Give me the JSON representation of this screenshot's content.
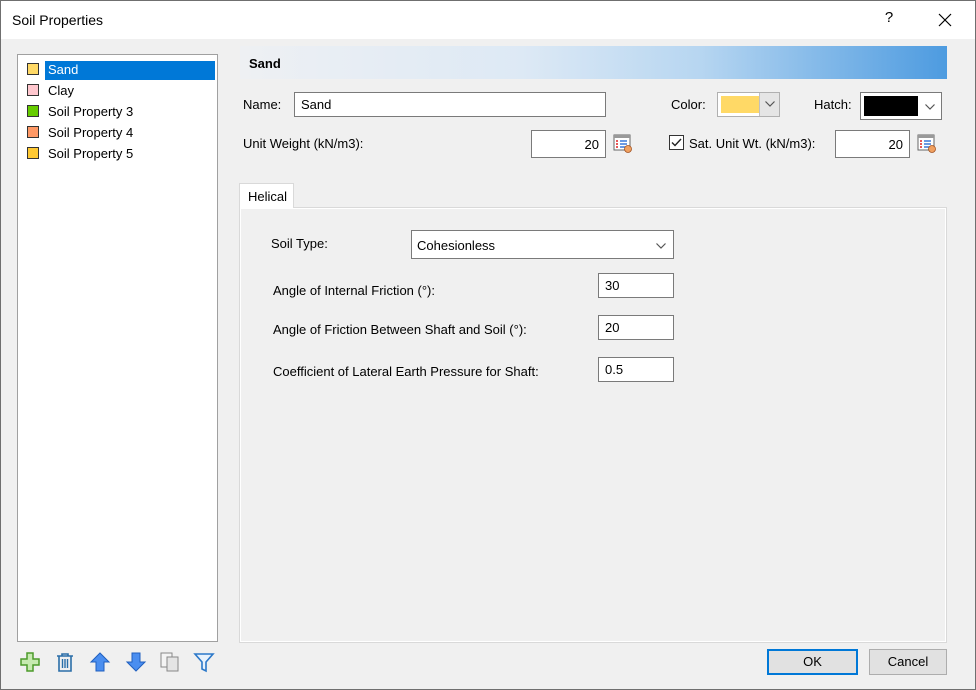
{
  "window": {
    "title": "Soil Properties",
    "help_label": "?",
    "close_icon": "close-icon"
  },
  "soil_list": {
    "items": [
      {
        "label": "Sand",
        "color": "#ffd966",
        "selected": true
      },
      {
        "label": "Clay",
        "color": "#ffc7ce",
        "selected": false
      },
      {
        "label": "Soil Property 3",
        "color": "#66cc00",
        "selected": false
      },
      {
        "label": "Soil Property 4",
        "color": "#ff9966",
        "selected": false
      },
      {
        "label": "Soil Property 5",
        "color": "#ffc933",
        "selected": false
      }
    ],
    "toolbar": [
      "add-icon",
      "delete-icon",
      "move-up-icon",
      "move-down-icon",
      "copy-icon",
      "filter-icon"
    ]
  },
  "header": {
    "title": "Sand"
  },
  "properties": {
    "name_label": "Name:",
    "name_value": "Sand",
    "color_label": "Color:",
    "color_value": "#ffd966",
    "hatch_label": "Hatch:",
    "hatch_value": "#000000",
    "unit_weight_label": "Unit Weight (kN/m3):",
    "unit_weight_value": "20",
    "sat_unit_wt_checked": true,
    "sat_unit_wt_label": "Sat. Unit Wt. (kN/m3):",
    "sat_unit_wt_value": "20"
  },
  "tabs": [
    {
      "label": "Helical",
      "active": true
    }
  ],
  "helical": {
    "soil_type_label": "Soil Type:",
    "soil_type_value": "Cohesionless",
    "friction_angle_label": "Angle of Internal Friction (°):",
    "friction_angle_value": "30",
    "shaft_friction_label": "Angle of Friction Between Shaft and Soil (°):",
    "shaft_friction_value": "20",
    "lateral_coeff_label": "Coefficient of Lateral Earth Pressure for Shaft:",
    "lateral_coeff_value": "0.5"
  },
  "buttons": {
    "ok": "OK",
    "cancel": "Cancel"
  }
}
